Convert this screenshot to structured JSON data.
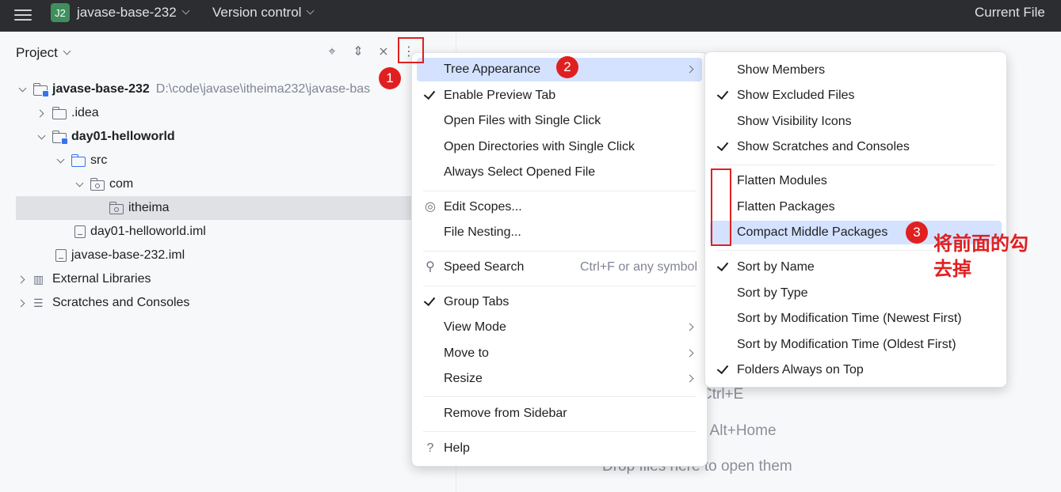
{
  "topbar": {
    "badge": "J2",
    "project_name": "javase-base-232",
    "version_control": "Version control",
    "current_file": "Current File"
  },
  "panel": {
    "title": "Project",
    "tree": [
      {
        "label": "javase-base-232",
        "path": "D:\\code\\javase\\itheima232\\javase-bas"
      },
      {
        "label": ".idea"
      },
      {
        "label": "day01-helloworld"
      },
      {
        "label": "src"
      },
      {
        "label": "com"
      },
      {
        "label": "itheima"
      },
      {
        "label": "day01-helloworld.iml"
      },
      {
        "label": "javase-base-232.iml"
      },
      {
        "label": "External Libraries"
      },
      {
        "label": "Scratches and Consoles"
      }
    ]
  },
  "editor_hints": {
    "line1": "Ctrl+E",
    "line2": "r Alt+Home",
    "line3": "Drop files here to open them"
  },
  "menu1": {
    "items": [
      {
        "label": "Tree Appearance"
      },
      {
        "label": "Enable Preview Tab"
      },
      {
        "label": "Open Files with Single Click"
      },
      {
        "label": "Open Directories with Single Click"
      },
      {
        "label": "Always Select Opened File"
      },
      {
        "label": "Edit Scopes..."
      },
      {
        "label": "File Nesting..."
      },
      {
        "label": "Speed Search",
        "shortcut": "Ctrl+F or any symbol"
      },
      {
        "label": "Group Tabs"
      },
      {
        "label": "View Mode"
      },
      {
        "label": "Move to"
      },
      {
        "label": "Resize"
      },
      {
        "label": "Remove from Sidebar"
      },
      {
        "label": "Help"
      }
    ]
  },
  "menu2": {
    "items": [
      {
        "label": "Show Members"
      },
      {
        "label": "Show Excluded Files"
      },
      {
        "label": "Show Visibility Icons"
      },
      {
        "label": "Show Scratches and Consoles"
      },
      {
        "label": "Flatten Modules"
      },
      {
        "label": "Flatten Packages"
      },
      {
        "label": "Compact Middle Packages"
      },
      {
        "label": "Sort by Name"
      },
      {
        "label": "Sort by Type"
      },
      {
        "label": "Sort by Modification Time (Newest First)"
      },
      {
        "label": "Sort by Modification Time (Oldest First)"
      },
      {
        "label": "Folders Always on Top"
      }
    ]
  },
  "annotations": {
    "step1": "1",
    "step2": "2",
    "step3": "3",
    "note_line1": "将前面的勾",
    "note_line2": "去掉"
  },
  "colors": {
    "accent": "#3574f0",
    "highlight": "#d4e2ff",
    "annotation_red": "#e02020",
    "titlebar": "#2b2d30"
  }
}
